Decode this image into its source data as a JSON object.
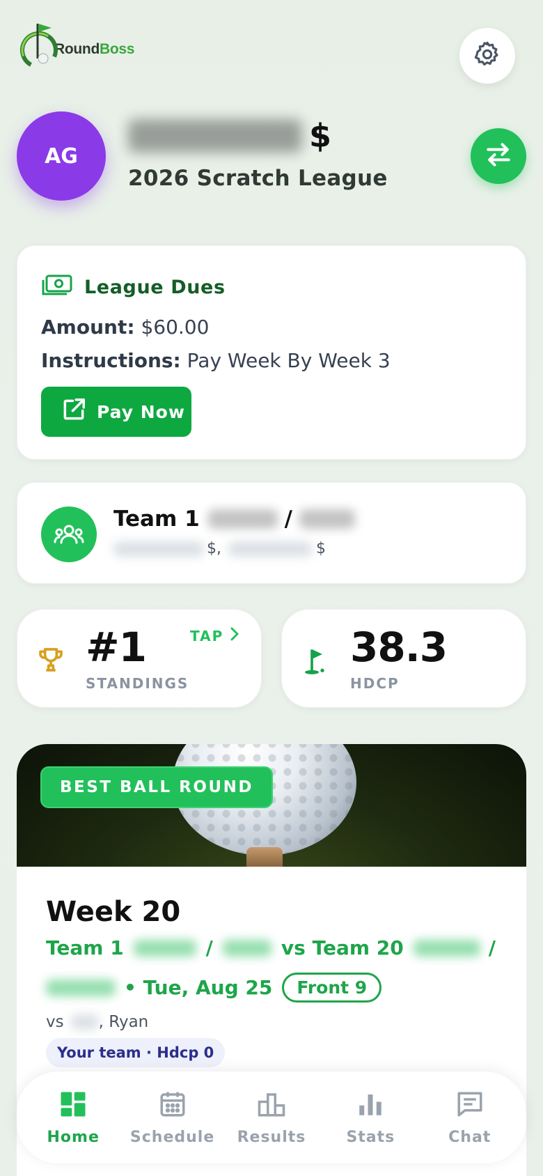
{
  "app": {
    "logo_text_a": "Round",
    "logo_text_b": "Boss"
  },
  "profile": {
    "initials": "AG",
    "dollar": "$",
    "league": "2026 Scratch League"
  },
  "dues": {
    "title": "League Dues",
    "amount_label": "Amount:",
    "amount_value": "$60.00",
    "instructions_label": "Instructions:",
    "instructions_value": "Pay Week By Week 3",
    "pay_button": "Pay Now"
  },
  "team": {
    "name": "Team 1",
    "separator": "/",
    "member_suffix_1": "$,",
    "member_suffix_2": "$"
  },
  "stats": {
    "standings_value": "#1",
    "standings_label": "STANDINGS",
    "tap_label": "TAP",
    "hdcp_value": "38.3",
    "hdcp_label": "HDCP"
  },
  "round": {
    "badge": "BEST BALL ROUND",
    "week": "Week 20",
    "team_a": "Team 1",
    "slash": "/",
    "vs_team": "vs Team 20",
    "date": "• Tue, Aug 25",
    "holes": "Front 9",
    "vs_prefix": "vs",
    "opponent": ", Ryan",
    "your_team": "Your team · Hdcp 0"
  },
  "nav": {
    "items": [
      {
        "label": "Home",
        "icon": "home-grid-icon",
        "active": true
      },
      {
        "label": "Schedule",
        "icon": "calendar-icon",
        "active": false
      },
      {
        "label": "Results",
        "icon": "podium-icon",
        "active": false
      },
      {
        "label": "Stats",
        "icon": "bar-chart-icon",
        "active": false
      },
      {
        "label": "Chat",
        "icon": "chat-icon",
        "active": false
      }
    ]
  },
  "colors": {
    "brand_green": "#22c05a",
    "avatar_purple": "#8b3ae8",
    "dues_title": "#155d27",
    "trophy_gold": "#d8a020"
  }
}
